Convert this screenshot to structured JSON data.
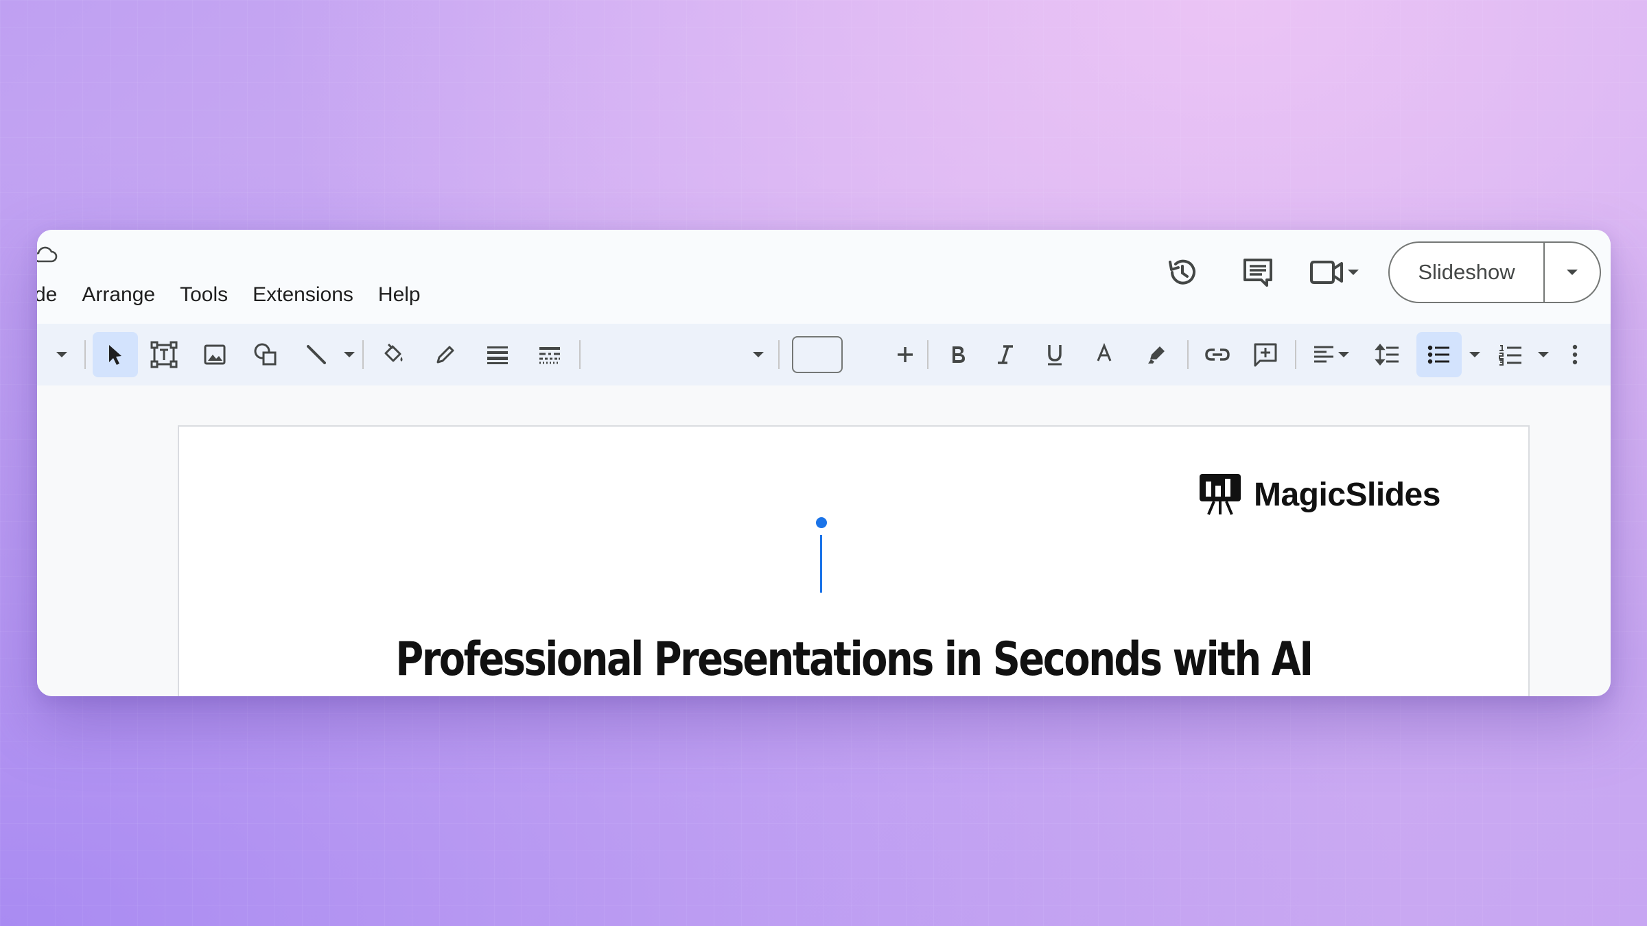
{
  "menu": {
    "items": [
      "de",
      "Arrange",
      "Tools",
      "Extensions",
      "Help"
    ]
  },
  "header": {
    "icons": [
      "version-history-icon",
      "comments-icon",
      "meet-camera-icon"
    ],
    "slideshow_label": "Slideshow"
  },
  "toolbar": {
    "icons": [
      "select-icon",
      "text-box-icon",
      "image-icon",
      "shape-icon",
      "line-icon",
      "fill-color-icon",
      "border-color-icon",
      "border-weight-icon",
      "border-dash-icon",
      "decrease-font-icon",
      "increase-font-icon",
      "bold-icon",
      "italic-icon",
      "underline-icon",
      "text-color-icon",
      "highlight-icon",
      "link-icon",
      "add-comment-icon",
      "align-icon",
      "line-spacing-icon",
      "bulleted-list-icon",
      "numbered-list-icon",
      "more-icon"
    ],
    "font_size_value": ""
  },
  "slide": {
    "logo_text": "MagicSlides",
    "title": "Professional Presentations in Seconds with AI"
  },
  "colors": {
    "accent": "#1a73e8",
    "toolbar_bg": "#edf2fa",
    "selected_bg": "#d3e3fd"
  }
}
